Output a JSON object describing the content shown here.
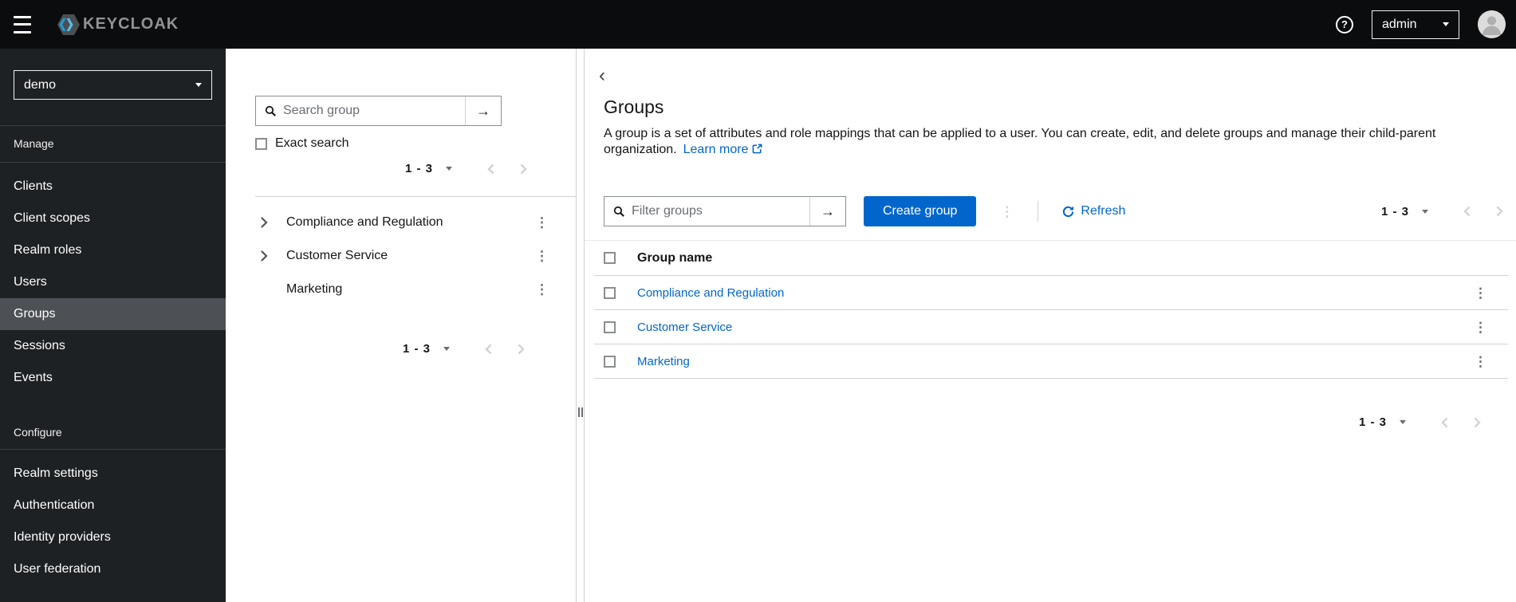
{
  "masthead": {
    "brand": "KEYCLOAK",
    "username": "admin"
  },
  "glyphs": {
    "question_mark": "?",
    "arrow_right": "→",
    "kebab": "⋮",
    "back_chevron": "‹"
  },
  "sidebar": {
    "realm": "demo",
    "selected_item": "Groups",
    "sections": [
      {
        "label": "Manage",
        "items": [
          "Clients",
          "Client scopes",
          "Realm roles",
          "Users",
          "Groups",
          "Sessions",
          "Events"
        ]
      },
      {
        "label": "Configure",
        "items": [
          "Realm settings",
          "Authentication",
          "Identity providers",
          "User federation"
        ]
      }
    ]
  },
  "tree_panel": {
    "search_placeholder": "Search group",
    "exact_search_label": "Exact search",
    "pagination_top": "1 - 3",
    "pagination_bottom": "1 - 3",
    "items": [
      {
        "label": "Compliance and Regulation",
        "expandable": true
      },
      {
        "label": "Customer Service",
        "expandable": true
      },
      {
        "label": "Marketing",
        "expandable": false
      }
    ]
  },
  "main": {
    "title": "Groups",
    "description": "A group is a set of attributes and role mappings that can be applied to a user. You can create, edit, and delete groups and manage their child-parent organization.",
    "learn_more_label": "Learn more",
    "toolbar": {
      "filter_placeholder": "Filter groups",
      "create_button_label": "Create group",
      "refresh_label": "Refresh",
      "pagination": "1 - 3"
    },
    "table": {
      "columns": [
        "Group name"
      ],
      "rows": [
        "Compliance and Regulation",
        "Customer Service",
        "Marketing"
      ]
    },
    "pagination_bottom": "1 - 3"
  },
  "colors": {
    "primary": "#0066cc",
    "link": "#0066cc",
    "masthead_bg": "#0b0c0d",
    "sidebar_bg": "#1e2124",
    "sidebar_selected_bg": "#4d5156",
    "keycloak_cyan": "#35b5e5",
    "border": "#d2d2d2"
  }
}
